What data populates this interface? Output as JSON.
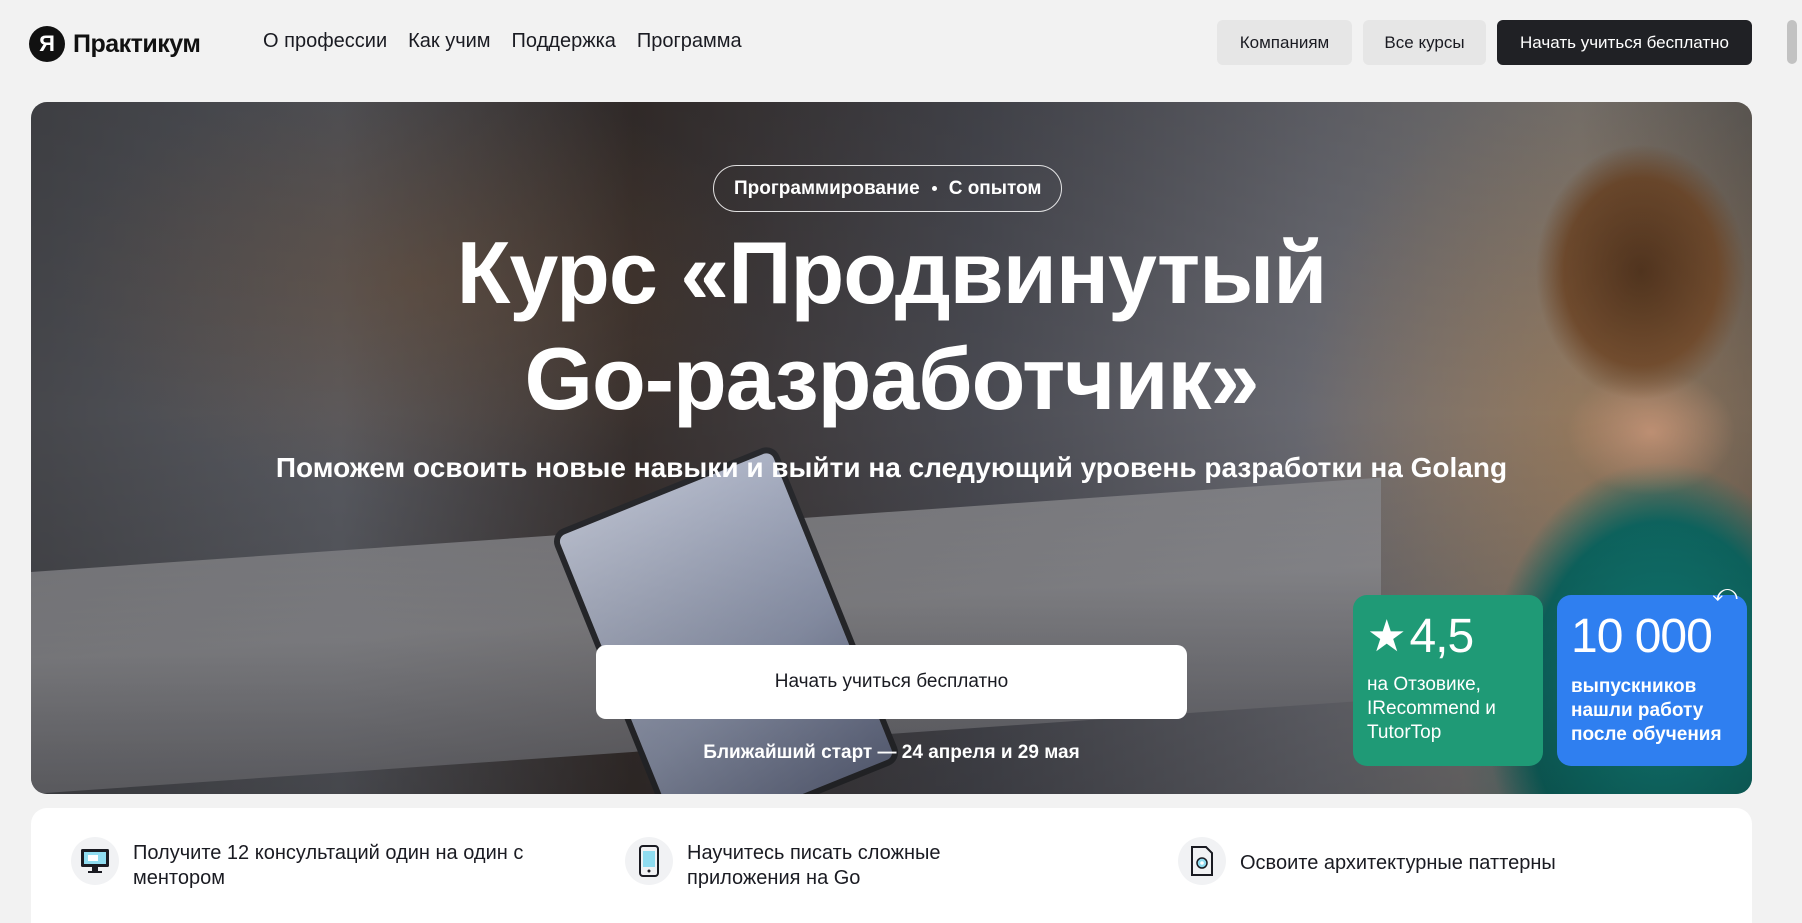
{
  "header": {
    "logo_mark": "Я",
    "logo_text": "Практикум",
    "nav": [
      "О профессии",
      "Как учим",
      "Поддержка",
      "Программа"
    ],
    "companies_label": "Компаниям",
    "all_courses_label": "Все курсы",
    "start_free_label": "Начать учиться бесплатно"
  },
  "hero": {
    "tag_category": "Программирование",
    "tag_level": "С опытом",
    "title_line1": "Курс «Продвинутый",
    "title_line2": "Go-разработчик»",
    "subtitle": "Поможем освоить новые навыки и выйти на следующий уровень разработки на Golang",
    "cta_label": "Начать учиться бесплатно",
    "start_dates": "Ближайший старт — 24 апреля и 29 мая"
  },
  "stats": {
    "rating_value": "4,5",
    "rating_caption": "на Отзовике, IRecommend и TutorTop",
    "graduates_value": "10 000",
    "graduates_caption": "выпускников нашли работу после обучения"
  },
  "features": [
    {
      "icon": "monitor-icon",
      "text": "Получите 12 консультаций один на один с ментором"
    },
    {
      "icon": "phone-app-icon",
      "text": "Научитесь писать сложные приложения на Go"
    },
    {
      "icon": "document-gear-icon",
      "text": "Освоите архитектурные паттерны"
    }
  ],
  "colors": {
    "green_card": "#1f9a76",
    "blue_card": "#2f7ff0",
    "dark_button": "#202125"
  }
}
